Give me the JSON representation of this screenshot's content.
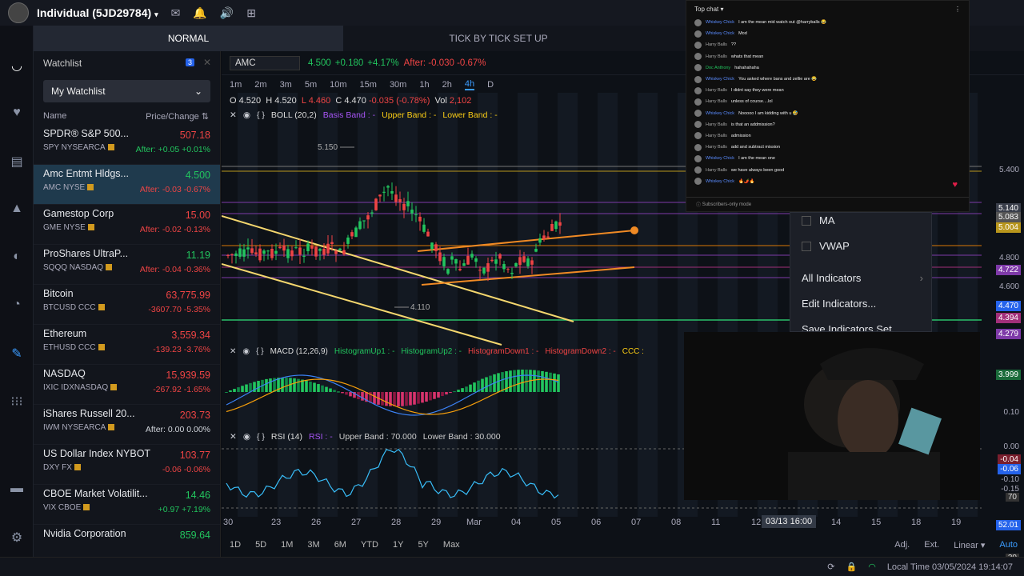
{
  "topbar": {
    "account": "Individual (5JD29784)",
    "account_caret": "▾"
  },
  "modebar": {
    "normal": "NORMAL",
    "tick": "TICK BY TICK SET UP"
  },
  "watchlist": {
    "title": "Watchlist",
    "badge": "3",
    "selected": "My Watchlist",
    "col_name": "Name",
    "col_price": "Price/Change",
    "rows": [
      {
        "name": "SPDR® S&P 500...",
        "price": "507.18",
        "ticker": "SPY NYSEARCA",
        "change": "After: +0.05 +0.01%",
        "price_color": "#ef4444",
        "change_color": "#22c55e"
      },
      {
        "name": "Amc Entmt Hldgs...",
        "price": "4.500",
        "ticker": "AMC NYSE",
        "change": "After: -0.03 -0.67%",
        "price_color": "#22c55e",
        "change_color": "#ef4444"
      },
      {
        "name": "Gamestop Corp",
        "price": "15.00",
        "ticker": "GME NYSE",
        "change": "After: -0.02 -0.13%",
        "price_color": "#ef4444",
        "change_color": "#ef4444"
      },
      {
        "name": "ProShares UltraP...",
        "price": "11.19",
        "ticker": "SQQQ NASDAQ",
        "change": "After: -0.04 -0.36%",
        "price_color": "#22c55e",
        "change_color": "#ef4444"
      },
      {
        "name": "Bitcoin",
        "price": "63,775.99",
        "ticker": "BTCUSD CCC",
        "change": "-3607.70 -5.35%",
        "price_color": "#ef4444",
        "change_color": "#ef4444"
      },
      {
        "name": "Ethereum",
        "price": "3,559.34",
        "ticker": "ETHUSD CCC",
        "change": "-139.23 -3.76%",
        "price_color": "#ef4444",
        "change_color": "#ef4444"
      },
      {
        "name": "NASDAQ",
        "price": "15,939.59",
        "ticker": "IXIC IDXNASDAQ",
        "change": "-267.92 -1.65%",
        "price_color": "#ef4444",
        "change_color": "#ef4444"
      },
      {
        "name": "iShares Russell 20...",
        "price": "203.73",
        "ticker": "IWM NYSEARCA",
        "change": "After: 0.00 0.00%",
        "price_color": "#ef4444",
        "change_color": "#d1d5db"
      },
      {
        "name": "US Dollar Index NYBOT",
        "price": "103.77",
        "ticker": "DXY FX",
        "change": "-0.06 -0.06%",
        "price_color": "#ef4444",
        "change_color": "#ef4444"
      },
      {
        "name": "CBOE Market Volatilit...",
        "price": "14.46",
        "ticker": "VIX CBOE",
        "change": "+0.97 +7.19%",
        "price_color": "#22c55e",
        "change_color": "#22c55e"
      },
      {
        "name": "Nvidia Corporation",
        "price": "859.64",
        "ticker": "",
        "change": "",
        "price_color": "#22c55e",
        "change_color": "#22c55e"
      }
    ]
  },
  "chart": {
    "symbol": "AMC",
    "last": "4.500",
    "chg": "+0.180",
    "pct": "+4.17%",
    "after": "After: -0.030 -0.67%",
    "timeframes": [
      "1m",
      "2m",
      "3m",
      "5m",
      "10m",
      "15m",
      "30m",
      "1h",
      "2h",
      "4h",
      "D"
    ],
    "active_tf": "4h",
    "ohlc": {
      "o": "O 4.520",
      "h": "H 4.520",
      "l": "L 4.460",
      "c": "C 4.470",
      "chg": "-0.035 (-0.78%)",
      "vol_label": "Vol",
      "vol": "2,102"
    },
    "boll": {
      "name": "BOLL (20,2)",
      "basis": "Basis Band : -",
      "upper": "Upper Band : -",
      "lower": "Lower Band : -"
    },
    "macd": {
      "name": "MACD (12,26,9)",
      "h1": "HistogramUp1 : -",
      "h2": "HistogramUp2 : -",
      "h3": "HistogramDown1 : -",
      "h4": "HistogramDown2 : -",
      "ccc": "CCC :"
    },
    "rsi": {
      "name": "RSI (14)",
      "val": "RSI : -",
      "upper": "Upper Band : 70.000",
      "lower": "Lower Band : 30.000"
    },
    "annot_high": "5.150",
    "annot_low": "4.110",
    "price_labels": [
      "5.400",
      "5.140",
      "5.083",
      "5.004",
      "4.800",
      "4.722",
      "4.600",
      "4.470",
      "4.394",
      "4.279",
      "3.999"
    ],
    "macd_labels": [
      "0.10",
      "0.00",
      "-0.04",
      "-0.06",
      "-0.10",
      "-0.15"
    ],
    "rsi_labels": [
      "70",
      "52.01",
      "30"
    ],
    "x_ticks": [
      "30",
      "23",
      "26",
      "27",
      "28",
      "29",
      "Mar",
      "04",
      "05",
      "06",
      "07",
      "08",
      "11",
      "12",
      "14",
      "15",
      "18",
      "19"
    ],
    "crosshair_time": "03/13 16:00",
    "ranges": [
      "1D",
      "5D",
      "1M",
      "3M",
      "6M",
      "YTD",
      "1Y",
      "5Y",
      "Max"
    ],
    "scale_opts": [
      "Adj.",
      "Ext.",
      "Linear ▾",
      "Auto"
    ]
  },
  "chart_data": {
    "type": "candlestick",
    "symbol": "AMC",
    "timeframe": "4h",
    "last_ohlc": {
      "open": 4.52,
      "high": 4.52,
      "low": 4.46,
      "close": 4.47
    },
    "annotated_high": 5.15,
    "annotated_low": 4.11,
    "ylim": [
      3.9,
      5.45
    ],
    "rsi_last": 52.01,
    "rsi_bands": [
      70,
      30
    ]
  },
  "chat": {
    "title": "Top chat ▾",
    "footer": "Subscribers-only mode",
    "lines": [
      {
        "user": "Whiskey Chick",
        "msg": "I am the mean mid watch out @harryballs 😂"
      },
      {
        "user": "Whiskey Chick",
        "msg": "Mod"
      },
      {
        "user": "Harry Balls",
        "msg": "??"
      },
      {
        "user": "Harry Balls",
        "msg": "whats that mean"
      },
      {
        "user": "Doc Anthony",
        "msg": "hahahahaha"
      },
      {
        "user": "Whiskey Chick",
        "msg": "You asked where bans and zellie are 😂"
      },
      {
        "user": "Harry Balls",
        "msg": "I didnt say they were mean"
      },
      {
        "user": "Harry Balls",
        "msg": "unless of course....lol"
      },
      {
        "user": "Whiskey Chick",
        "msg": "Nooooo I am kidding with u 🤣"
      },
      {
        "user": "Harry Balls",
        "msg": "is that an addmission?"
      },
      {
        "user": "Harry Balls",
        "msg": "admission"
      },
      {
        "user": "Harry Balls",
        "msg": "add and subtract mission"
      },
      {
        "user": "Whiskey Chick",
        "msg": "I am the mean one"
      },
      {
        "user": "Harry Balls",
        "msg": "we have always been good"
      },
      {
        "user": "Whiskey Chick",
        "msg": "🔥🌶️🔥"
      }
    ]
  },
  "indicators_menu": {
    "ma": "MA",
    "vwap": "VWAP",
    "all": "All Indicators",
    "edit": "Edit Indicators...",
    "save": "Save Indicators Set"
  },
  "status": {
    "time": "Local Time 03/05/2024 19:14:07"
  }
}
